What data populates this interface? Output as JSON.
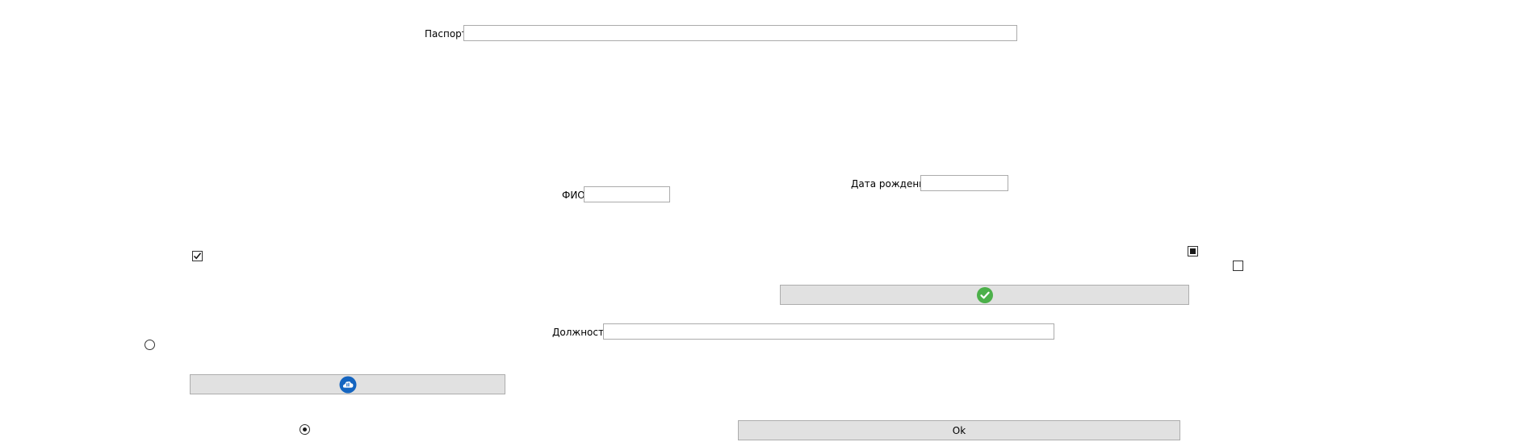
{
  "form": {
    "passport": {
      "label": "Паспорт",
      "value": ""
    },
    "fio": {
      "label": "ФИО",
      "value": ""
    },
    "birth_date": {
      "label": "Дата рождения",
      "value": ""
    },
    "position": {
      "label": "Должность",
      "value": ""
    }
  },
  "checkboxes": [
    {
      "state": "checked"
    },
    {
      "state": "indeterminate"
    },
    {
      "state": "unchecked"
    }
  ],
  "radios": [
    {
      "state": "unchecked"
    },
    {
      "state": "checked"
    }
  ],
  "buttons": {
    "confirm": {
      "label": "",
      "icon": "green-checkmark-icon",
      "icon_color": "#4cb04a"
    },
    "cloud": {
      "label": "",
      "icon": "blue-cloud-app-icon",
      "icon_color": "#1565c0"
    },
    "ok": {
      "label": "Ok"
    }
  },
  "colors": {
    "button_face": "#e1e1e1",
    "button_border": "#adadad",
    "field_border": "#ababab"
  }
}
